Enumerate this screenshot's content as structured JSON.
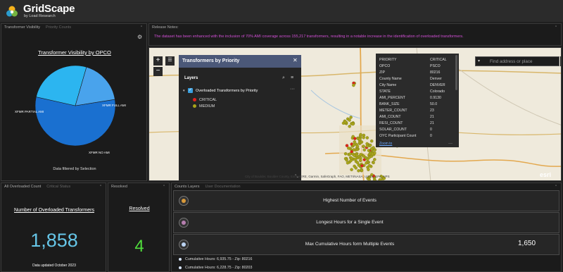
{
  "header": {
    "title": "GridScape",
    "subtitle": "by Load Research"
  },
  "visibility_panel": {
    "tabs": [
      "Transformer Visibility",
      "Priority Counts"
    ],
    "title": "Transformer Visibility by OPCO",
    "footer": "Data filtered by Selection",
    "chart_data": {
      "type": "pie",
      "labels": [
        "XFMR NO AMI",
        "XFMR PARTIAL AMI",
        "XFMR FULL AMI"
      ],
      "values": [
        56,
        26,
        18
      ],
      "colors": [
        "#1a70d0",
        "#2cb5f0",
        "#49a3ec"
      ]
    }
  },
  "notes_panel": {
    "tab": "Release Notes:",
    "text": "The dataset has been enhanced with the inclusion of 70% AMI coverage across 155,217 transformers, resulting in a notable increase in the identification of overloaded transformers."
  },
  "map": {
    "layer_panel": {
      "title": "Transformers by Priority",
      "section": "Layers",
      "layer_name": "Overloaded Transformers by Priority",
      "legend": [
        {
          "label": "CRITICAL",
          "color": "#e0201c"
        },
        {
          "label": "MEDIUM",
          "color": "#a8a41a"
        }
      ]
    },
    "popup": {
      "rows": [
        {
          "key": "PRIORITY",
          "value": "CRITICAL"
        },
        {
          "key": "OPCO",
          "value": "PSCO"
        },
        {
          "key": "ZIP",
          "value": "80216"
        },
        {
          "key": "County Name",
          "value": "Denver"
        },
        {
          "key": "City Name",
          "value": "DENVER"
        },
        {
          "key": "STATE",
          "value": "Colorado"
        },
        {
          "key": "AMI_PERCENT",
          "value": "0.9130"
        },
        {
          "key": "BANK_SIZE",
          "value": "50.0"
        },
        {
          "key": "METER_COUNT",
          "value": "23"
        },
        {
          "key": "AMI_COUNT",
          "value": "21"
        },
        {
          "key": "RESI_COUNT",
          "value": "21"
        },
        {
          "key": "SOLAR_COUNT",
          "value": "0"
        },
        {
          "key": "OYC Participant Count",
          "value": "0"
        }
      ],
      "zoom_link": "Zoom to"
    },
    "search_placeholder": "Find address or place",
    "attribution": "City of Boulder, Boulder County, Esri, HERE, Garmin, SafeGraph, FAO, METI/NASA, USGS, EPA, NPS",
    "esri_logo": "esri"
  },
  "count_panel": {
    "tabs": [
      "All Overloaded Count",
      "Critical Status"
    ],
    "title": "Number of Overloaded Transformers",
    "value": "1,858",
    "footer": "Data updated October 2023"
  },
  "resolved_panel": {
    "tab": "Resolved",
    "title": "Resolved",
    "value": "4"
  },
  "layers_panel": {
    "tabs": [
      "Counts Layers",
      "User Documentation"
    ],
    "accordions": [
      {
        "label": "Highest Number of Events",
        "value": "",
        "icon_color": "#d99a3a"
      },
      {
        "label": "Longest Hours for a Single Event",
        "value": "",
        "icon_color": "#b77fb0"
      },
      {
        "label": "Max Cumulative Hours form Multiple Events",
        "value": "1,650",
        "icon_color": "#bcd3f2"
      }
    ],
    "list": [
      "Cumulative Hours: 6,935.75 - Zip: 80216",
      "Cumulative Hours: 6,228.75 - Zip: 80203"
    ]
  }
}
